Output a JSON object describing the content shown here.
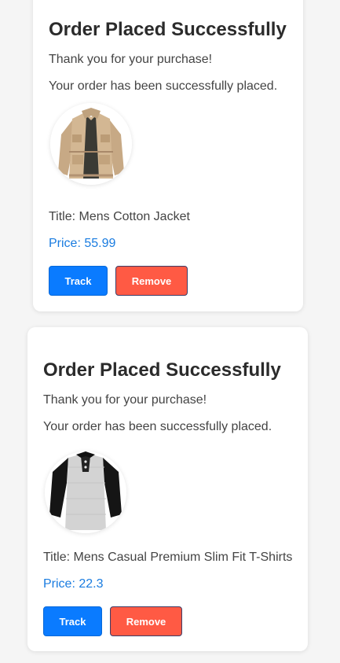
{
  "orders": [
    {
      "heading": "Order Placed Successfully",
      "thanks": "Thank you for your purchase!",
      "message": "Your order has been successfully placed.",
      "title_text": "Title: Mens Cotton Jacket",
      "price_text": "Price: 55.99",
      "track_label": "Track",
      "remove_label": "Remove"
    },
    {
      "heading": "Order Placed Successfully",
      "thanks": "Thank you for your purchase!",
      "message": "Your order has been successfully placed.",
      "title_text": "Title: Mens Casual Premium Slim Fit T-Shirts",
      "price_text": "Price: 22.3",
      "track_label": "Track",
      "remove_label": "Remove"
    }
  ],
  "colors": {
    "page_background": "#f5f5f5",
    "card_background": "#ffffff",
    "price_text": "#1a7ce0",
    "track_button": "#0a7bff",
    "remove_button": "#ff5a44"
  }
}
